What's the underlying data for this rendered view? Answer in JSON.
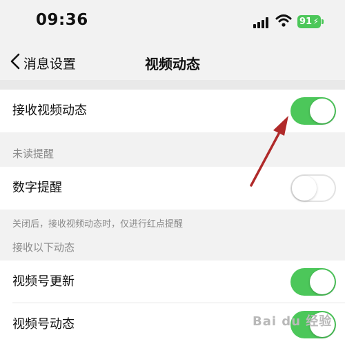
{
  "status_bar": {
    "time": "09:36",
    "battery_level": "91",
    "battery_color": "#4cc759"
  },
  "nav": {
    "back_label": "消息设置",
    "title": "视频动态"
  },
  "receive": {
    "label": "接收视频动态",
    "enabled": true
  },
  "unread": {
    "header": "未读提醒",
    "label": "数字提醒",
    "enabled": false,
    "note": "关闭后，接收视频动态时，仅进行红点提醒"
  },
  "receive_following": {
    "header": "接收以下动态",
    "items": [
      {
        "label": "视频号更新",
        "enabled": true
      },
      {
        "label": "视频号动态",
        "enabled": true
      }
    ]
  },
  "colors": {
    "toggle_on": "#4cc75a",
    "annotation_arrow": "#b02a2a"
  },
  "watermark": "Bai du 经验"
}
